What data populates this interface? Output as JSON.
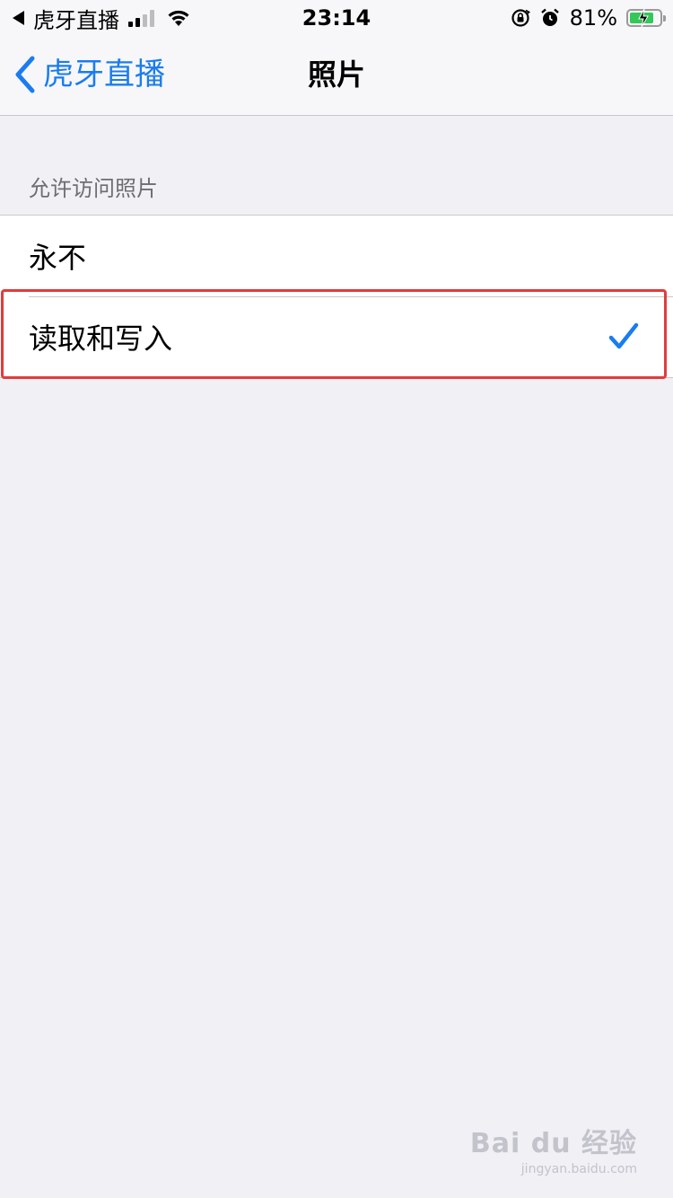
{
  "status_bar": {
    "back_app": "虎牙直播",
    "time": "23:14",
    "battery_percent": "81%",
    "battery_level": 0.81,
    "battery_color": "#34c759"
  },
  "nav": {
    "back_label": "虎牙直播",
    "title": "照片",
    "accent": "#1a7cf0"
  },
  "section": {
    "header": "允许访问照片",
    "options": [
      {
        "label": "永不",
        "selected": false
      },
      {
        "label": "读取和写入",
        "selected": true
      }
    ]
  },
  "annotation": {
    "highlight_color": "#e23b3b"
  },
  "watermark": {
    "brand": "Bai du 经验",
    "url": "jingyan.baidu.com"
  }
}
